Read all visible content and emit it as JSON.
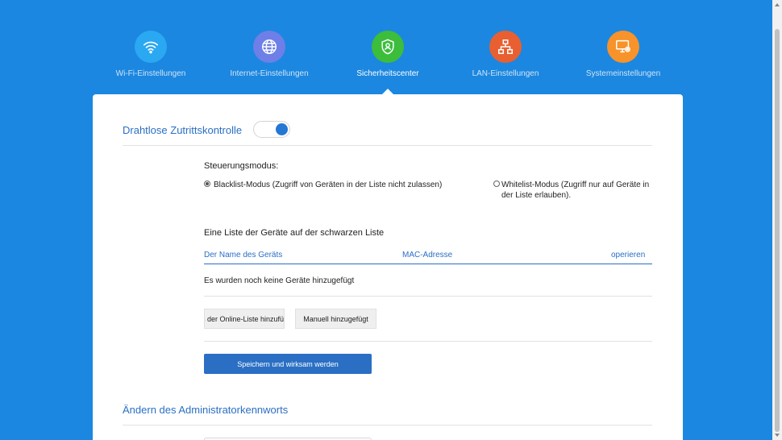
{
  "nav": {
    "items": [
      {
        "label": "Wi-Fi-Einstellungen",
        "color": "#2aa8f2",
        "icon": "wifi-icon"
      },
      {
        "label": "Internet-Einstellungen",
        "color": "#6e7fe8",
        "icon": "globe-icon"
      },
      {
        "label": "Sicherheitscenter",
        "color": "#3cbd3c",
        "icon": "shield-icon"
      },
      {
        "label": "LAN-Einstellungen",
        "color": "#e85f32",
        "icon": "network-icon"
      },
      {
        "label": "Systemeinstellungen",
        "color": "#f7932a",
        "icon": "monitor-settings-icon"
      }
    ],
    "active_index": 2
  },
  "access_control": {
    "title": "Drahtlose Zutrittskontrolle",
    "enabled": true,
    "mode_label": "Steuerungsmodus:",
    "blacklist_option": "Blacklist-Modus (Zugriff von Geräten in der Liste nicht zulassen)",
    "whitelist_option": "Whitelist-Modus (Zugriff nur auf Geräte in der Liste erlauben).",
    "selected_mode": "blacklist",
    "list_title": "Eine Liste der Geräte auf der schwarzen Liste",
    "columns": [
      "Der Name des Geräts",
      "MAC-Adresse",
      "operieren"
    ],
    "empty_text": "Es wurden noch keine Geräte hinzugefügt",
    "add_online_label": "Aus der Online-Liste hinzufügen",
    "add_manual_label": "Manuell hinzugefügt",
    "save_label": "Speichern und wirksam werden"
  },
  "admin_password": {
    "title": "Ändern des Administratorkennworts"
  }
}
